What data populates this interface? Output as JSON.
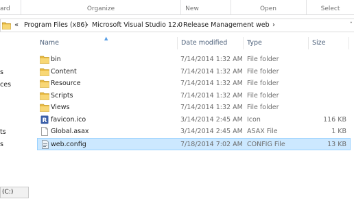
{
  "ribbon": {
    "groups": [
      "ard",
      "Organize",
      "New",
      "Open",
      "Select"
    ]
  },
  "address": {
    "back_chevron": "«",
    "crumbs": [
      "Program Files (x86)",
      "Microsoft Visual Studio 12.0",
      "Release Management",
      "web"
    ],
    "separator": "›",
    "dropdown": "ˇ"
  },
  "nav": {
    "fragments": [
      "s",
      "ces",
      "ts",
      "s"
    ],
    "drive": "(C:)"
  },
  "columns": {
    "name": "Name",
    "date_modified": "Date modified",
    "type": "Type",
    "size": "Size"
  },
  "files": [
    {
      "name": "bin",
      "date": "7/14/2014 1:32 AM",
      "type": "File folder",
      "size": "",
      "icon": "folder-icon"
    },
    {
      "name": "Content",
      "date": "7/14/2014 1:32 AM",
      "type": "File folder",
      "size": "",
      "icon": "folder-icon"
    },
    {
      "name": "Resource",
      "date": "7/14/2014 1:32 AM",
      "type": "File folder",
      "size": "",
      "icon": "folder-icon"
    },
    {
      "name": "Scripts",
      "date": "7/14/2014 1:32 AM",
      "type": "File folder",
      "size": "",
      "icon": "folder-icon"
    },
    {
      "name": "Views",
      "date": "7/14/2014 1:32 AM",
      "type": "File folder",
      "size": "",
      "icon": "folder-icon"
    },
    {
      "name": "favicon.ico",
      "date": "3/14/2014 2:45 AM",
      "type": "Icon",
      "size": "116 KB",
      "icon": "favicon-icon"
    },
    {
      "name": "Global.asax",
      "date": "3/14/2014 2:45 AM",
      "type": "ASAX File",
      "size": "1 KB",
      "icon": "file-icon"
    },
    {
      "name": "web.config",
      "date": "7/18/2014 7:02 AM",
      "type": "CONFIG File",
      "size": "13 KB",
      "icon": "config-file-icon",
      "selected": true
    }
  ],
  "colors": {
    "selection_bg": "#cce8ff",
    "selection_border": "#99d1ff",
    "folder_yellow": "#f2c94c",
    "header_text": "#4c607a"
  }
}
